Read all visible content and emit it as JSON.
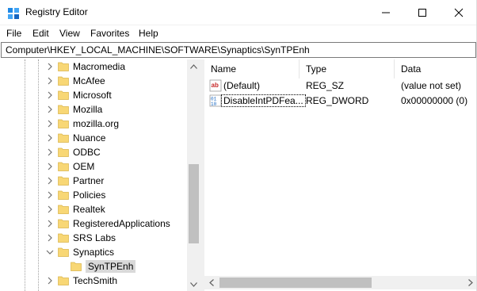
{
  "window": {
    "title": "Registry Editor"
  },
  "menubar": {
    "items": [
      "File",
      "Edit",
      "View",
      "Favorites",
      "Help"
    ]
  },
  "address": {
    "path": "Computer\\HKEY_LOCAL_MACHINE\\SOFTWARE\\Synaptics\\SynTPEnh"
  },
  "tree": {
    "items": [
      {
        "label": "Macromedia",
        "expanded": false
      },
      {
        "label": "McAfee",
        "expanded": false
      },
      {
        "label": "Microsoft",
        "expanded": false
      },
      {
        "label": "Mozilla",
        "expanded": false
      },
      {
        "label": "mozilla.org",
        "expanded": false
      },
      {
        "label": "Nuance",
        "expanded": false
      },
      {
        "label": "ODBC",
        "expanded": false
      },
      {
        "label": "OEM",
        "expanded": false
      },
      {
        "label": "Partner",
        "expanded": false
      },
      {
        "label": "Policies",
        "expanded": false
      },
      {
        "label": "Realtek",
        "expanded": false
      },
      {
        "label": "RegisteredApplications",
        "expanded": false
      },
      {
        "label": "SRS Labs",
        "expanded": false
      },
      {
        "label": "Synaptics",
        "expanded": true
      },
      {
        "label": "SynTPEnh",
        "expanded": false,
        "selected": true
      },
      {
        "label": "TechSmith",
        "expanded": false
      }
    ]
  },
  "list": {
    "columns": [
      "Name",
      "Type",
      "Data"
    ],
    "rows": [
      {
        "name": "(Default)",
        "type": "REG_SZ",
        "data": "(value not set)",
        "icon": "string-value-icon"
      },
      {
        "name": "DisableIntPDFea...",
        "type": "REG_DWORD",
        "data": "0x00000000 (0)",
        "icon": "binary-value-icon"
      }
    ]
  },
  "colors": {
    "folder": "#f8d775",
    "selection": "#d9d9d9"
  }
}
